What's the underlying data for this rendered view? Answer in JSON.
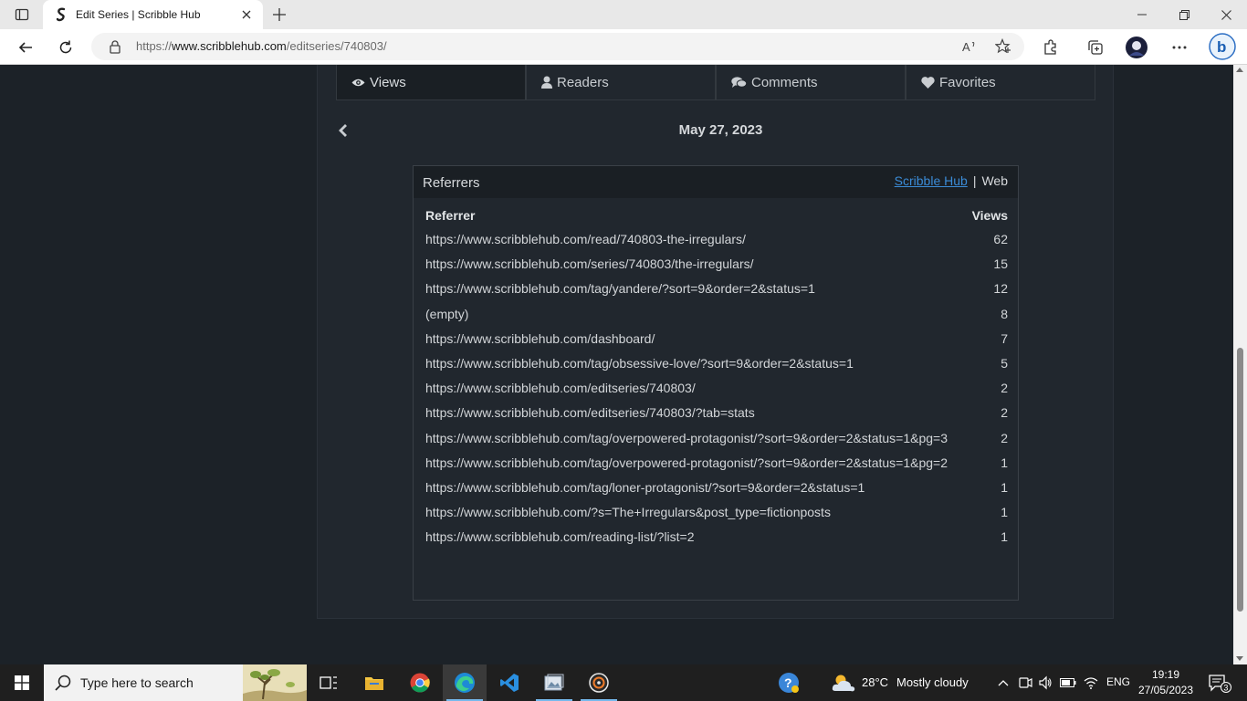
{
  "browser": {
    "tab_title": "Edit Series | Scribble Hub",
    "url_prefix": "https://",
    "url_host": "www.scribblehub.com",
    "url_path": "/editseries/740803/"
  },
  "stats_tabs": [
    {
      "label": "Views",
      "icon": "eye-icon",
      "active": true
    },
    {
      "label": "Readers",
      "icon": "user-icon",
      "active": false
    },
    {
      "label": "Comments",
      "icon": "comments-icon",
      "active": false
    },
    {
      "label": "Favorites",
      "icon": "heart-icon",
      "active": false
    }
  ],
  "date": "May 27, 2023",
  "referrers": {
    "title": "Referrers",
    "source_active": "Scribble Hub",
    "source_separator": "|",
    "source_other": "Web",
    "col_referrer": "Referrer",
    "col_views": "Views",
    "rows": [
      {
        "url": "https://www.scribblehub.com/read/740803-the-irregulars/",
        "views": "62"
      },
      {
        "url": "https://www.scribblehub.com/series/740803/the-irregulars/",
        "views": "15"
      },
      {
        "url": "https://www.scribblehub.com/tag/yandere/?sort=9&order=2&status=1",
        "views": "12"
      },
      {
        "url": "(empty)",
        "views": "8"
      },
      {
        "url": "https://www.scribblehub.com/dashboard/",
        "views": "7"
      },
      {
        "url": "https://www.scribblehub.com/tag/obsessive-love/?sort=9&order=2&status=1",
        "views": "5"
      },
      {
        "url": "https://www.scribblehub.com/editseries/740803/",
        "views": "2"
      },
      {
        "url": "https://www.scribblehub.com/editseries/740803/?tab=stats",
        "views": "2"
      },
      {
        "url": "https://www.scribblehub.com/tag/overpowered-protagonist/?sort=9&order=2&status=1&pg=3",
        "views": "2"
      },
      {
        "url": "https://www.scribblehub.com/tag/overpowered-protagonist/?sort=9&order=2&status=1&pg=2",
        "views": "1"
      },
      {
        "url": "https://www.scribblehub.com/tag/loner-protagonist/?sort=9&order=2&status=1",
        "views": "1"
      },
      {
        "url": "https://www.scribblehub.com/?s=The+Irregulars&post_type=fictionposts",
        "views": "1"
      },
      {
        "url": "https://www.scribblehub.com/reading-list/?list=2",
        "views": "1"
      }
    ]
  },
  "taskbar": {
    "search_placeholder": "Type here to search",
    "weather_temp": "28°C",
    "weather_desc": "Mostly cloudy",
    "language": "ENG",
    "time": "19:19",
    "date": "27/05/2023",
    "notification_count": "3"
  },
  "colors": {
    "page_bg": "#1c2228",
    "panel_bg": "#21272e",
    "link_blue": "#3b8bd6"
  }
}
